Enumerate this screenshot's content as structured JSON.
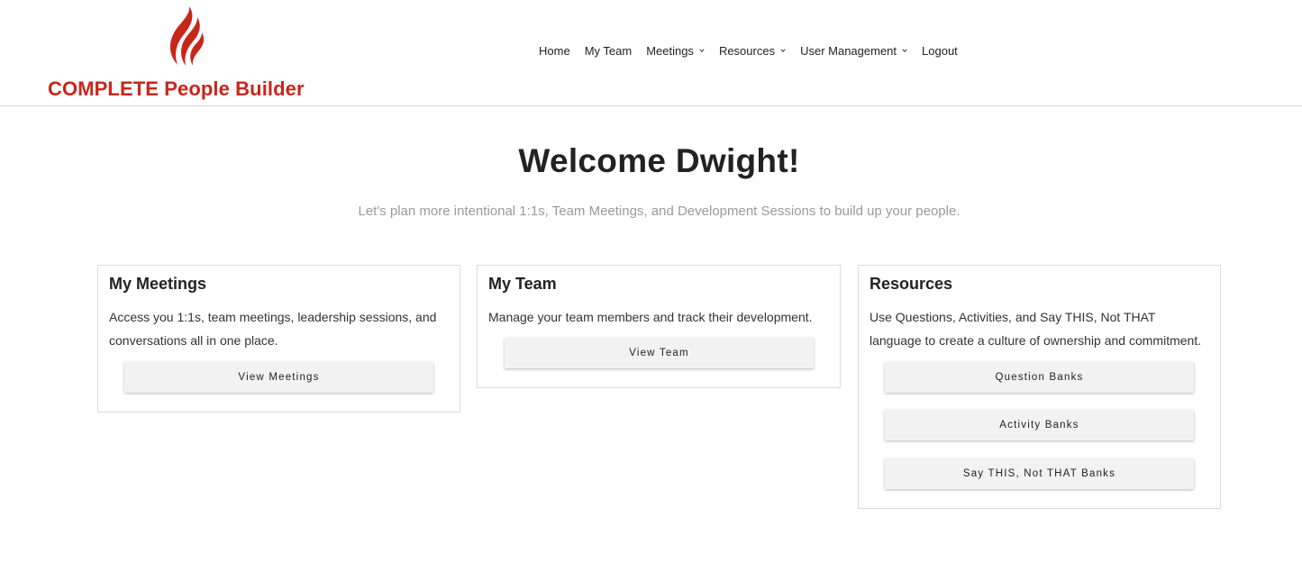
{
  "brand": {
    "name": "COMPLETE People Builder",
    "color": "#c8261b"
  },
  "nav": {
    "items": [
      {
        "label": "Home",
        "dropdown": false
      },
      {
        "label": "My Team",
        "dropdown": false
      },
      {
        "label": "Meetings",
        "dropdown": true
      },
      {
        "label": "Resources",
        "dropdown": true
      },
      {
        "label": "User Management",
        "dropdown": true
      },
      {
        "label": "Logout",
        "dropdown": false
      }
    ]
  },
  "main": {
    "title": "Welcome Dwight!",
    "subtitle": "Let's plan more intentional 1:1s, Team Meetings, and Development Sessions to build up your people."
  },
  "cards": {
    "meetings": {
      "title": "My Meetings",
      "text": "Access you 1:1s, team meetings, leadership sessions, and conversations all in one place.",
      "button": "View Meetings"
    },
    "team": {
      "title": "My Team",
      "text": "Manage your team members and track their development.",
      "button": "View Team"
    },
    "resources": {
      "title": "Resources",
      "text": "Use Questions, Activities, and Say THIS, Not THAT language to create a culture of ownership and commitment.",
      "buttons": [
        "Question Banks",
        "Activity Banks",
        "Say THIS, Not THAT Banks"
      ]
    }
  }
}
